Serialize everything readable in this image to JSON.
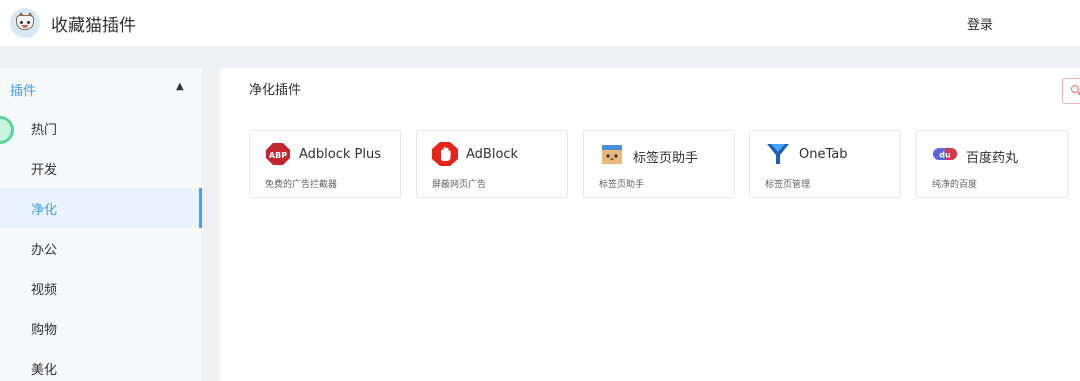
{
  "header": {
    "app_title": "收藏猫插件",
    "login_label": "登录"
  },
  "sidebar": {
    "group_label": "插件",
    "items": [
      {
        "label": "热门",
        "active": false
      },
      {
        "label": "开发",
        "active": false
      },
      {
        "label": "净化",
        "active": true
      },
      {
        "label": "办公",
        "active": false
      },
      {
        "label": "视频",
        "active": false
      },
      {
        "label": "购物",
        "active": false
      },
      {
        "label": "美化",
        "active": false
      }
    ]
  },
  "main": {
    "title": "净化插件",
    "cards": [
      {
        "name": "Adblock Plus",
        "desc": "免费的广告拦截器",
        "icon": "abp-icon",
        "icon_text": "ABP"
      },
      {
        "name": "AdBlock",
        "desc": "屏蔽网页广告",
        "icon": "adblock-hand-icon"
      },
      {
        "name": "标签页助手",
        "desc": "标签页助手",
        "icon": "tab-helper-icon"
      },
      {
        "name": "OneTab",
        "desc": "标签页管理",
        "icon": "onetab-funnel-icon"
      },
      {
        "name": "百度药丸",
        "desc": "纯净的百度",
        "icon": "baidu-pill-icon",
        "icon_text": "du"
      }
    ]
  },
  "colors": {
    "accent": "#409eff",
    "sidebar_bg": "#f7f8fa",
    "strip_bg": "#eef0f3",
    "abp_red": "#c1272d",
    "adblock_red": "#e6241b",
    "onetab_blue": "#1e5fb8",
    "baidu_pill": "#5b67d9"
  }
}
